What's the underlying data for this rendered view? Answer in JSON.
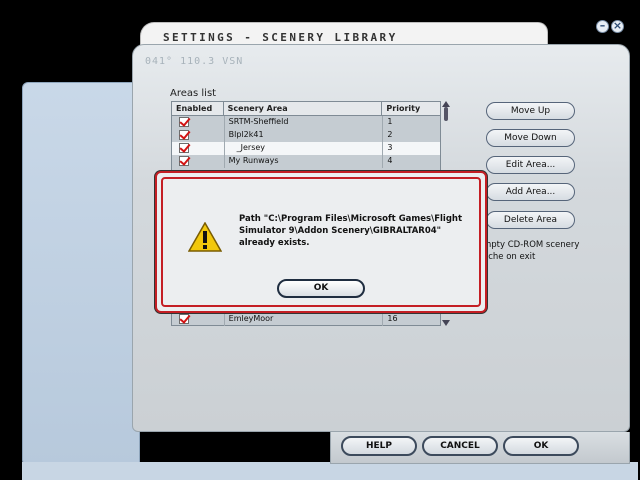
{
  "window": {
    "title": "SETTINGS - SCENERY LIBRARY",
    "minimize_symbol": "–",
    "close_symbol": "×"
  },
  "watermark": "041° 110.3 VSN",
  "areas": {
    "label": "Areas list",
    "columns": [
      "Enabled",
      "Scenery Area",
      "Priority"
    ],
    "rows": [
      {
        "enabled": true,
        "name": "SRTM-Sheffield",
        "priority": "1"
      },
      {
        "enabled": true,
        "name": "Blpl2k41",
        "priority": "2"
      },
      {
        "enabled": true,
        "name": "_Jersey",
        "priority": "3"
      },
      {
        "enabled": true,
        "name": "My Runways",
        "priority": "4"
      }
    ],
    "bottom_row": {
      "enabled": true,
      "name": "EmleyMoor",
      "priority": "16"
    }
  },
  "side_buttons": {
    "move_up": "Move Up",
    "move_down": "Move Down",
    "edit_area": "Edit Area...",
    "add_area": "Add Area...",
    "delete_area": "Delete Area"
  },
  "side_text_line1": "mpty CD-ROM scenery",
  "side_text_line2": "ache on exit",
  "bottom_buttons": {
    "help": "HELP",
    "cancel": "CANCEL",
    "ok": "OK"
  },
  "dialog": {
    "icon": "warning-icon",
    "line1": "Path \"C:\\Program Files\\Microsoft Games\\Flight",
    "line2": "Simulator 9\\Addon Scenery\\GIBRALTAR04\"",
    "line3": "already exists.",
    "ok_label": "OK"
  },
  "colors": {
    "accent_red": "#c41e24",
    "panel_grey": "#d4d9dd",
    "side_blue": "#c9d8e8"
  }
}
